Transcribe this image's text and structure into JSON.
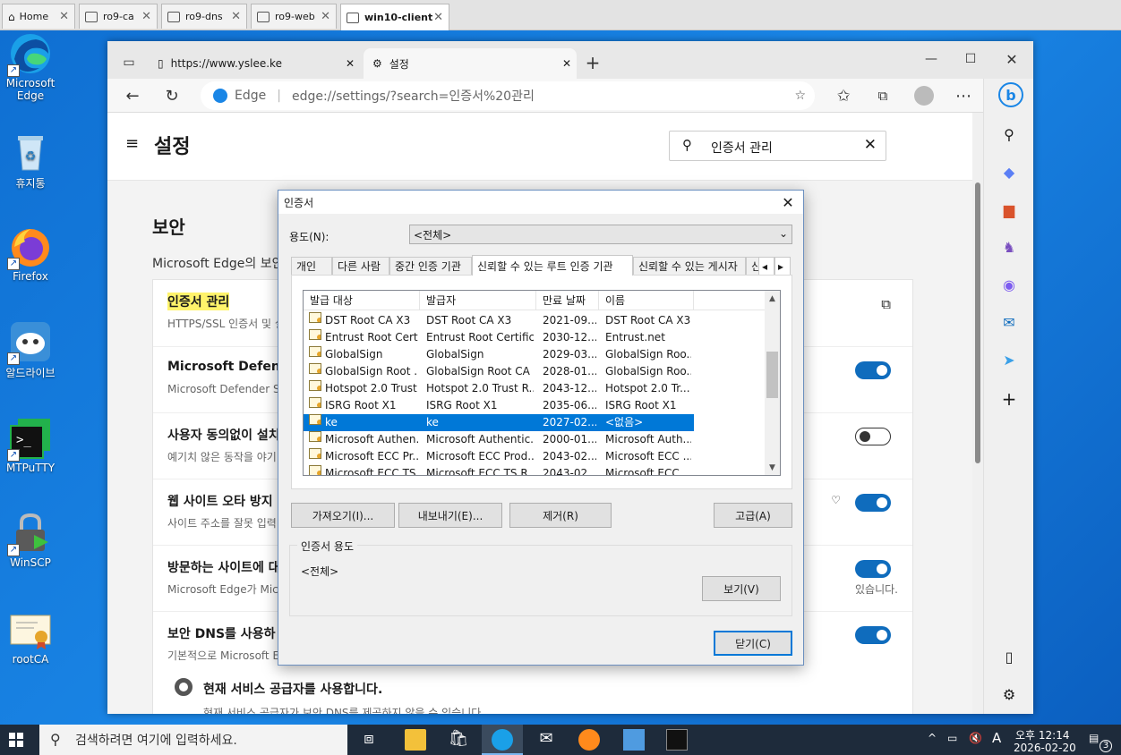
{
  "vm_tabs": [
    {
      "label": "Home"
    },
    {
      "label": "ro9-ca"
    },
    {
      "label": "ro9-dns"
    },
    {
      "label": "ro9-web"
    },
    {
      "label": "win10-client"
    }
  ],
  "desktop_icons": [
    {
      "label": "Microsoft Edge"
    },
    {
      "label": "휴지통"
    },
    {
      "label": "Firefox"
    },
    {
      "label": "알드라이브"
    },
    {
      "label": "MTPuTTY"
    },
    {
      "label": "WinSCP"
    },
    {
      "label": "rootCA"
    }
  ],
  "browser": {
    "tab1_title": "https://www.yslee.ke",
    "tab2_title": "설정",
    "edge_label": "Edge",
    "url": "edge://settings/?search=인증서%20관리"
  },
  "settings": {
    "title": "설정",
    "search_value": "인증서 관리",
    "section_title": "보안",
    "section_desc": "Microsoft Edge의 보안",
    "rows": [
      {
        "title": "인증서 관리",
        "desc": "HTTPS/SSL 인증서 및 설"
      },
      {
        "title": "Microsoft Defende",
        "desc": "Microsoft Defender Sm"
      },
      {
        "title": "사용자 동의없이 설치",
        "desc": "예기치 않은 동작을 야기"
      },
      {
        "title": "웹 사이트 오타 방지",
        "desc": "사이트 주소를 잘못 입력"
      },
      {
        "title": "방문하는 사이트에 대",
        "desc": "Microsoft Edge가 Micro",
        "desc_tail": "있습니다."
      },
      {
        "title": "보안 DNS를 사용하",
        "desc": "기본적으로 Microsoft E"
      }
    ],
    "radio_label": "현재 서비스 공급자를 사용합니다.",
    "radio_desc": "현재 서비스 공급자가 보안 DNS를 제공하지 않을 수 있습니다."
  },
  "dialog": {
    "title": "인증서",
    "purpose_label": "용도(N):",
    "purpose_value": "<전체>",
    "tabs": [
      "개인",
      "다른 사람",
      "중간 인증 기관",
      "신뢰할 수 있는 루트 인증 기관",
      "신뢰할 수 있는 게시자",
      "신"
    ],
    "columns": [
      "발급 대상",
      "발급자",
      "만료 날짜",
      "이름"
    ],
    "rows": [
      {
        "to": "DST Root CA X3",
        "by": "DST Root CA X3",
        "exp": "2021-09...",
        "name": "DST Root CA X3"
      },
      {
        "to": "Entrust Root Certi...",
        "by": "Entrust Root Certific...",
        "exp": "2030-12...",
        "name": "Entrust.net"
      },
      {
        "to": "GlobalSign",
        "by": "GlobalSign",
        "exp": "2029-03...",
        "name": "GlobalSign Roo..."
      },
      {
        "to": "GlobalSign Root ...",
        "by": "GlobalSign Root CA",
        "exp": "2028-01...",
        "name": "GlobalSign Roo..."
      },
      {
        "to": "Hotspot 2.0 Trust...",
        "by": "Hotspot 2.0 Trust R...",
        "exp": "2043-12...",
        "name": "Hotspot 2.0 Tr..."
      },
      {
        "to": "ISRG Root X1",
        "by": "ISRG Root X1",
        "exp": "2035-06...",
        "name": "ISRG Root X1"
      },
      {
        "to": "ke",
        "by": "ke",
        "exp": "2027-02...",
        "name": "<없음>",
        "selected": true
      },
      {
        "to": "Microsoft Authen...",
        "by": "Microsoft Authentic...",
        "exp": "2000-01...",
        "name": "Microsoft Auth..."
      },
      {
        "to": "Microsoft ECC Pr...",
        "by": "Microsoft ECC Prod...",
        "exp": "2043-02...",
        "name": "Microsoft ECC ..."
      },
      {
        "to": "Microsoft ECC TS...",
        "by": "Microsoft ECC TS R...",
        "exp": "2043-02...",
        "name": "Microsoft ECC ..."
      }
    ],
    "import_label": "가져오기(I)...",
    "export_label": "내보내기(E)...",
    "remove_label": "제거(R)",
    "advanced_label": "고급(A)",
    "purposes_group": "인증서 용도",
    "purposes_value": "<전체>",
    "view_label": "보기(V)",
    "close_label": "닫기(C)"
  },
  "taskbar": {
    "search_placeholder": "검색하려면 여기에 입력하세요.",
    "ampm_time": "오후 12:14",
    "date": "2026-02-20",
    "ime": "A",
    "notif_count": "3"
  }
}
